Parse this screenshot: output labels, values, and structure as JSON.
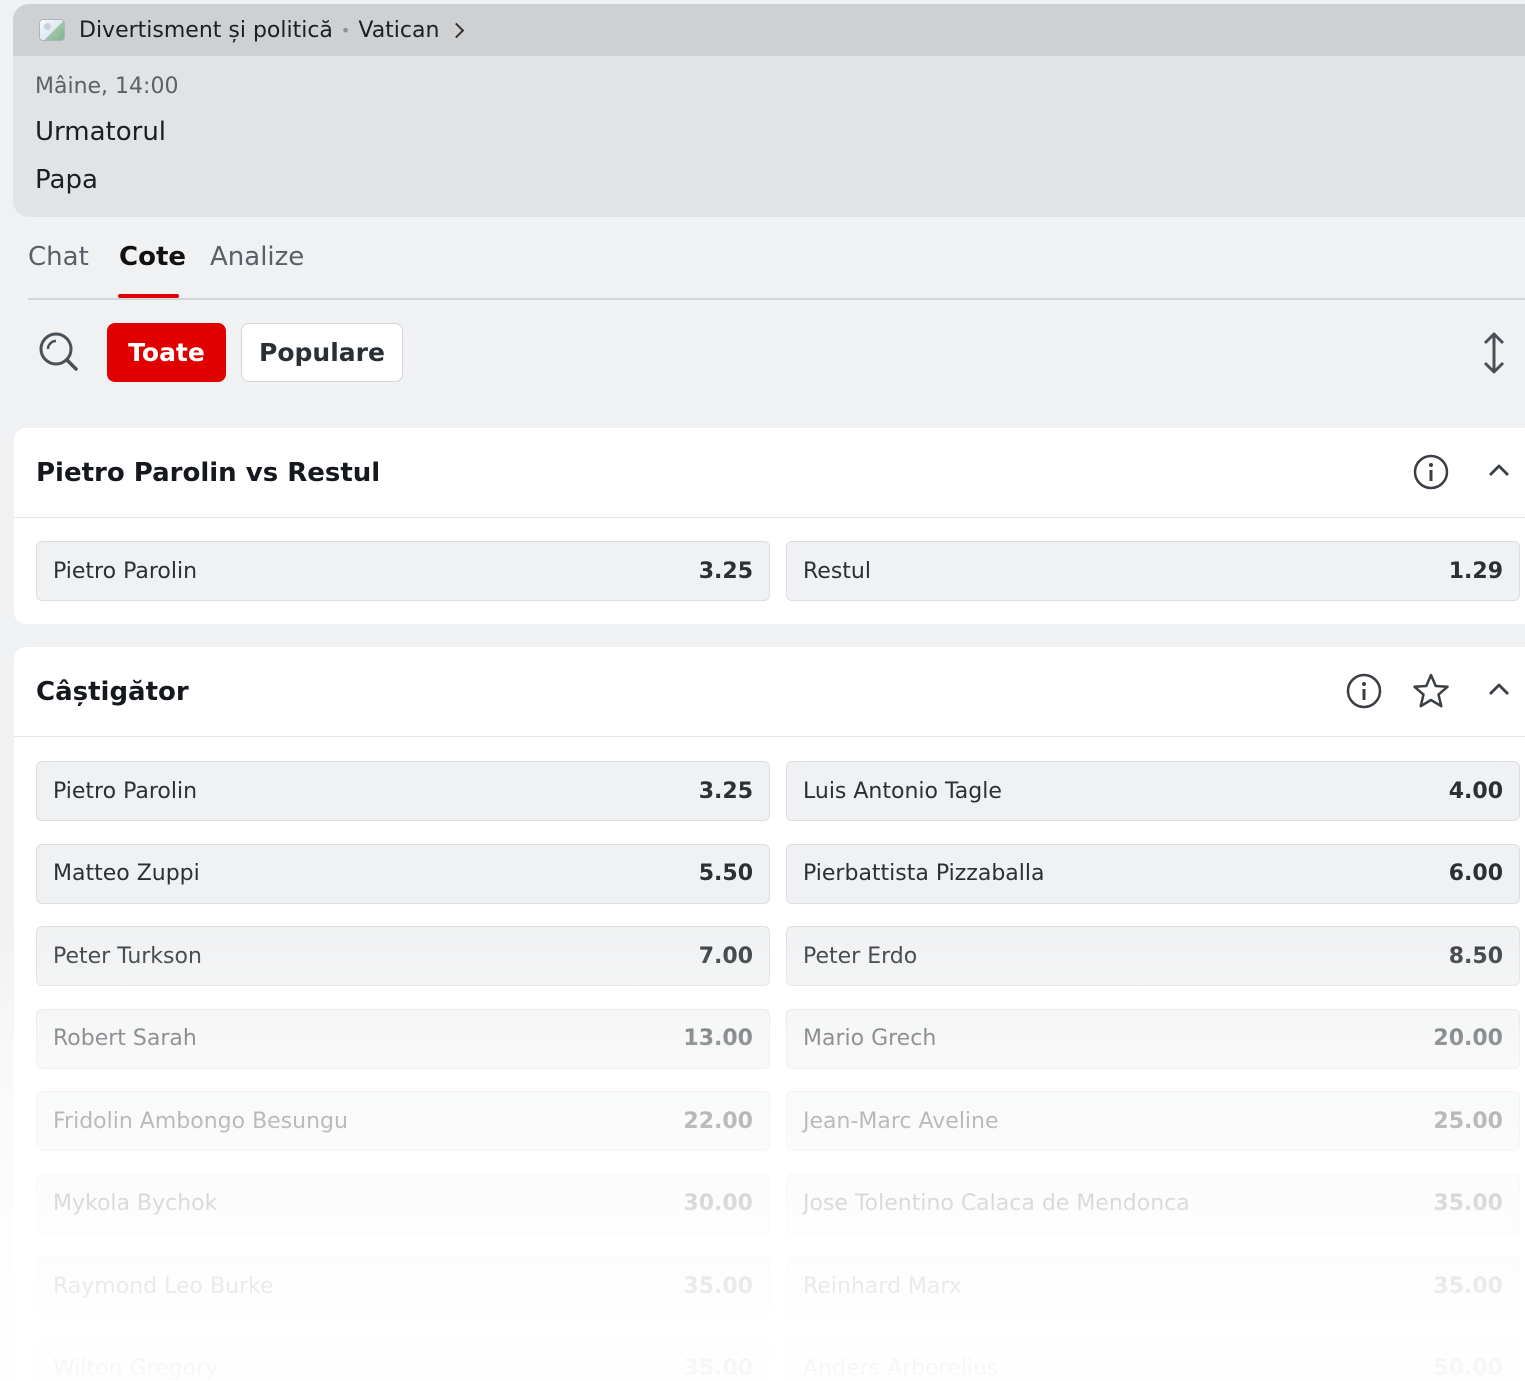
{
  "header": {
    "category": "Divertisment și politică",
    "subcategory": "Vatican",
    "time": "Mâine, 14:00",
    "event_line1": "Urmatorul",
    "event_line2": "Papa"
  },
  "tabs": [
    {
      "label": "Chat"
    },
    {
      "label": "Cote"
    },
    {
      "label": "Analize"
    }
  ],
  "filters": {
    "all": "Toate",
    "popular": "Populare"
  },
  "markets": [
    {
      "title": "Pietro Parolin vs Restul",
      "odds": [
        {
          "name": "Pietro Parolin",
          "price": "3.25"
        },
        {
          "name": "Restul",
          "price": "1.29"
        }
      ]
    },
    {
      "title": "Câștigător",
      "odds": [
        {
          "name": "Pietro Parolin",
          "price": "3.25"
        },
        {
          "name": "Luis Antonio Tagle",
          "price": "4.00"
        },
        {
          "name": "Matteo Zuppi",
          "price": "5.50"
        },
        {
          "name": "Pierbattista Pizzaballa",
          "price": "6.00"
        },
        {
          "name": "Peter Turkson",
          "price": "7.00"
        },
        {
          "name": "Peter Erdo",
          "price": "8.50"
        },
        {
          "name": "Robert Sarah",
          "price": "13.00"
        },
        {
          "name": "Mario Grech",
          "price": "20.00"
        },
        {
          "name": "Fridolin Ambongo Besungu",
          "price": "22.00"
        },
        {
          "name": "Jean-Marc Aveline",
          "price": "25.00"
        },
        {
          "name": "Mykola Bychok",
          "price": "30.00"
        },
        {
          "name": "Jose Tolentino Calaca de Mendonca",
          "price": "35.00"
        },
        {
          "name": "Raymond Leo Burke",
          "price": "35.00"
        },
        {
          "name": "Reinhard Marx",
          "price": "35.00"
        },
        {
          "name": "Wilton Gregory",
          "price": "35.00"
        },
        {
          "name": "Anders Arborelius",
          "price": "50.00"
        }
      ]
    }
  ]
}
